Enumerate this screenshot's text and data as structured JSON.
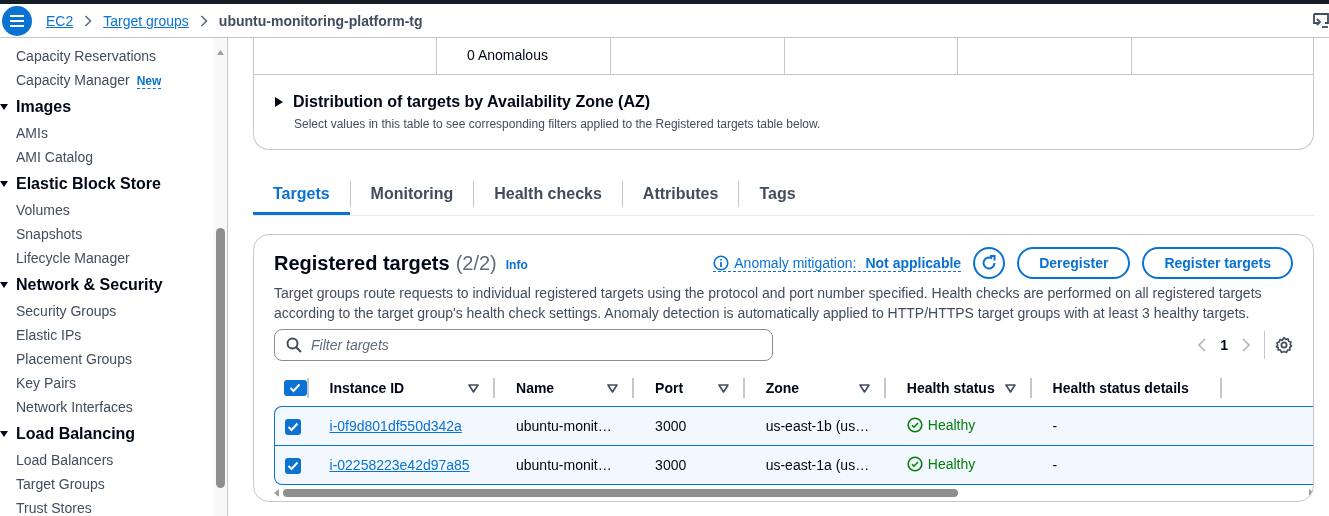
{
  "breadcrumbs": [
    {
      "label": "EC2",
      "link": true
    },
    {
      "label": "Target groups",
      "link": true
    },
    {
      "label": "ubuntu-monitoring-platform-tg",
      "link": false
    }
  ],
  "sidebar": {
    "sections": [
      {
        "items": [
          {
            "label": "Capacity Reservations"
          },
          {
            "label": "Capacity Manager",
            "badge": "New"
          }
        ]
      },
      {
        "title": "Images",
        "expanded": true,
        "items": [
          {
            "label": "AMIs"
          },
          {
            "label": "AMI Catalog"
          }
        ]
      },
      {
        "title": "Elastic Block Store",
        "expanded": true,
        "items": [
          {
            "label": "Volumes"
          },
          {
            "label": "Snapshots"
          },
          {
            "label": "Lifecycle Manager"
          }
        ]
      },
      {
        "title": "Network & Security",
        "expanded": true,
        "items": [
          {
            "label": "Security Groups"
          },
          {
            "label": "Elastic IPs"
          },
          {
            "label": "Placement Groups"
          },
          {
            "label": "Key Pairs"
          },
          {
            "label": "Network Interfaces"
          }
        ]
      },
      {
        "title": "Load Balancing",
        "expanded": true,
        "items": [
          {
            "label": "Load Balancers"
          },
          {
            "label": "Target Groups"
          },
          {
            "label": "Trust Stores"
          }
        ]
      }
    ]
  },
  "summary": {
    "anomalous": "0 Anomalous"
  },
  "distribution": {
    "title": "Distribution of targets by Availability Zone (AZ)",
    "expanded": false,
    "description": "Select values in this table to see corresponding filters applied to the Registered targets table below."
  },
  "tabs": [
    {
      "label": "Targets",
      "selected": true
    },
    {
      "label": "Monitoring",
      "selected": false
    },
    {
      "label": "Health checks",
      "selected": false
    },
    {
      "label": "Attributes",
      "selected": false
    },
    {
      "label": "Tags",
      "selected": false
    }
  ],
  "registered_targets": {
    "title": "Registered targets",
    "count": "(2/2)",
    "info": "Info",
    "anomaly_label": "Anomaly mitigation:",
    "anomaly_value": "Not applicable",
    "buttons": [
      "Deregister",
      "Register targets"
    ],
    "description": "Target groups route requests to individual registered targets using the protocol and port number specified. Health checks are performed on all registered targets according to the target group's health check settings. Anomaly detection is automatically applied to HTTP/HTTPS target groups with at least 3 healthy targets.",
    "filter": {
      "placeholder": "Filter targets"
    },
    "page": "1"
  },
  "table": {
    "header_checked": true,
    "columns": [
      "Instance ID",
      "Name",
      "Port",
      "Zone",
      "Health status",
      "Health status details"
    ],
    "rows": [
      {
        "selected": true,
        "checked": true,
        "instance_id": "i-0f9d801df550d342a",
        "name": "ubuntu-monit…",
        "port": "3000",
        "zone": "us-east-1b (us…",
        "health": {
          "kind": "healthy",
          "text": "Healthy"
        },
        "details": "-"
      },
      {
        "selected": true,
        "checked": true,
        "instance_id": "i-02258223e42d97a85",
        "name": "ubuntu-monit…",
        "port": "3000",
        "zone": "us-east-1a (us…",
        "health": {
          "kind": "healthy",
          "text": "Healthy"
        },
        "details": "-"
      }
    ]
  }
}
